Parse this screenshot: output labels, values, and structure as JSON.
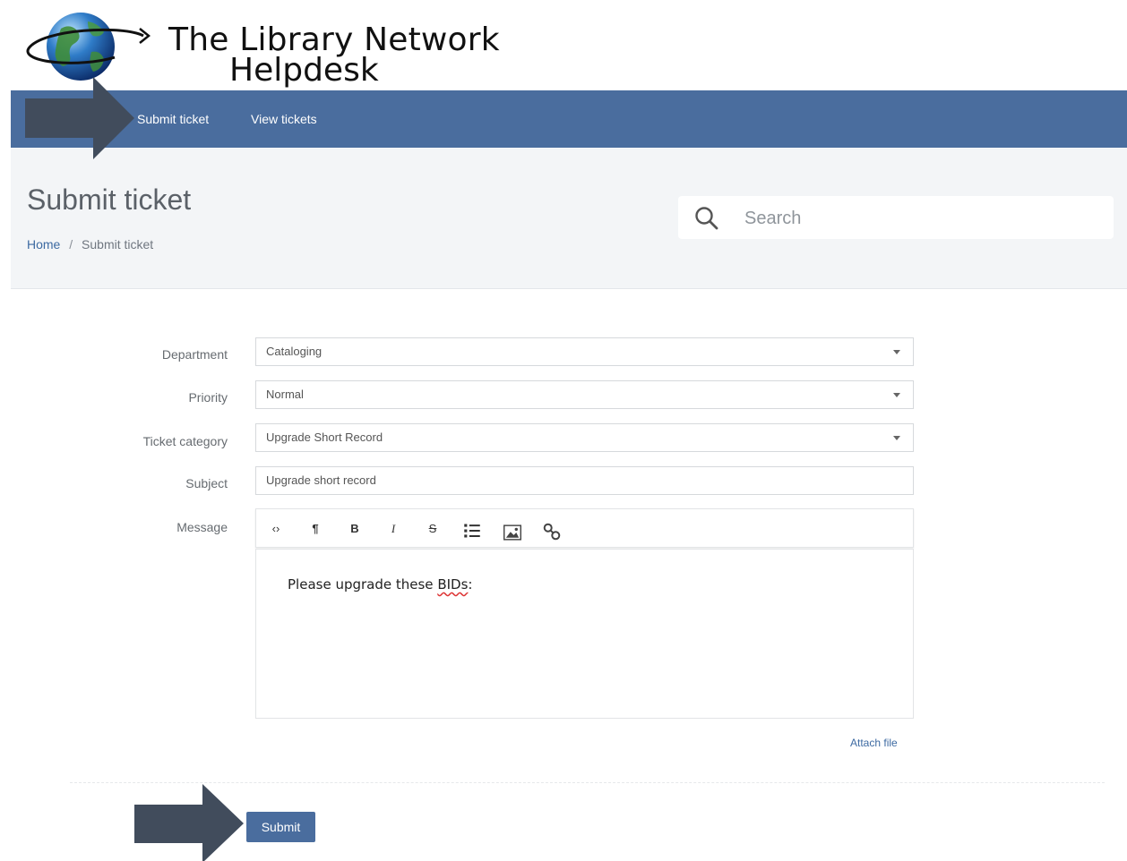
{
  "logo": {
    "line1": "The Library Network",
    "line2": "Helpdesk"
  },
  "nav": {
    "submit_ticket": "Submit ticket",
    "view_tickets": "View tickets"
  },
  "header": {
    "title": "Submit ticket",
    "breadcrumb": {
      "home": "Home",
      "separator": "/",
      "current": "Submit ticket"
    },
    "search_placeholder": "Search"
  },
  "form": {
    "department": {
      "label": "Department",
      "value": "Cataloging"
    },
    "priority": {
      "label": "Priority",
      "value": "Normal"
    },
    "ticket_category": {
      "label": "Ticket category",
      "value": "Upgrade Short Record"
    },
    "subject": {
      "label": "Subject",
      "value": "Upgrade short record"
    },
    "message": {
      "label": "Message",
      "text_before": "Please upgrade these ",
      "text_misspelled": "BIDs",
      "text_after": ":"
    },
    "toolbar": {
      "code": "‹›",
      "paragraph": "¶",
      "bold": "B",
      "italic": "I",
      "strike": "S"
    },
    "attach_label": "Attach file",
    "submit_label": "Submit"
  },
  "colors": {
    "navbar": "#4a6d9e",
    "arrow": "#414c5c",
    "link": "#3d6aa2",
    "header_bg": "#f3f5f7"
  }
}
